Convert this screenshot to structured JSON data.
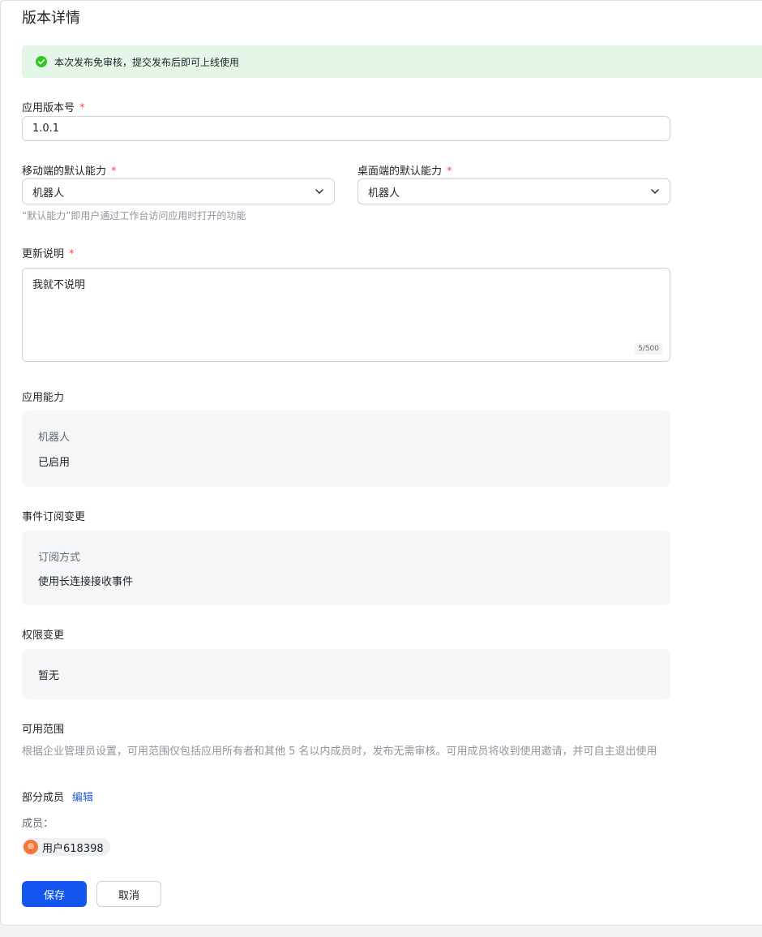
{
  "title": "版本详情",
  "notice": {
    "text": "本次发布免审核，提交发布后即可上线使用",
    "icon": "check-circle-icon",
    "color": "#34c724"
  },
  "version": {
    "label": "应用版本号",
    "required_mark": "*",
    "value": "1.0.1"
  },
  "mobile_default": {
    "label": "移动端的默认能力",
    "required_mark": "*",
    "value": "机器人",
    "icon": "chevron-down-icon"
  },
  "desktop_default": {
    "label": "桌面端的默认能力",
    "required_mark": "*",
    "value": "机器人",
    "icon": "chevron-down-icon"
  },
  "default_hint": "“默认能力”即用户通过工作台访问应用时打开的功能",
  "update_notes": {
    "label": "更新说明",
    "required_mark": "*",
    "value": "我就不说明",
    "counter": "5/500"
  },
  "app_capability": {
    "title": "应用能力",
    "name": "机器人",
    "status": "已启用"
  },
  "event_subscription": {
    "title": "事件订阅变更",
    "sub_label": "订阅方式",
    "value": "使用长连接接收事件"
  },
  "permission_change": {
    "title": "权限变更",
    "value": "暂无"
  },
  "availability": {
    "title": "可用范围",
    "description": "根据企业管理员设置，可用范围仅包括应用所有者和其他 5 名以内成员时，发布无需审核。可用成员将收到使用邀请，并可自主退出使用",
    "scope": "部分成员",
    "edit_label": "编辑",
    "members_label": "成员：",
    "members": [
      {
        "name": "用户618398"
      }
    ]
  },
  "actions": {
    "save": "保存",
    "cancel": "取消"
  },
  "colors": {
    "primary": "#1456f0",
    "required": "#f54a45",
    "link": "#245bdb",
    "success_bg": "#e4f6e8"
  }
}
